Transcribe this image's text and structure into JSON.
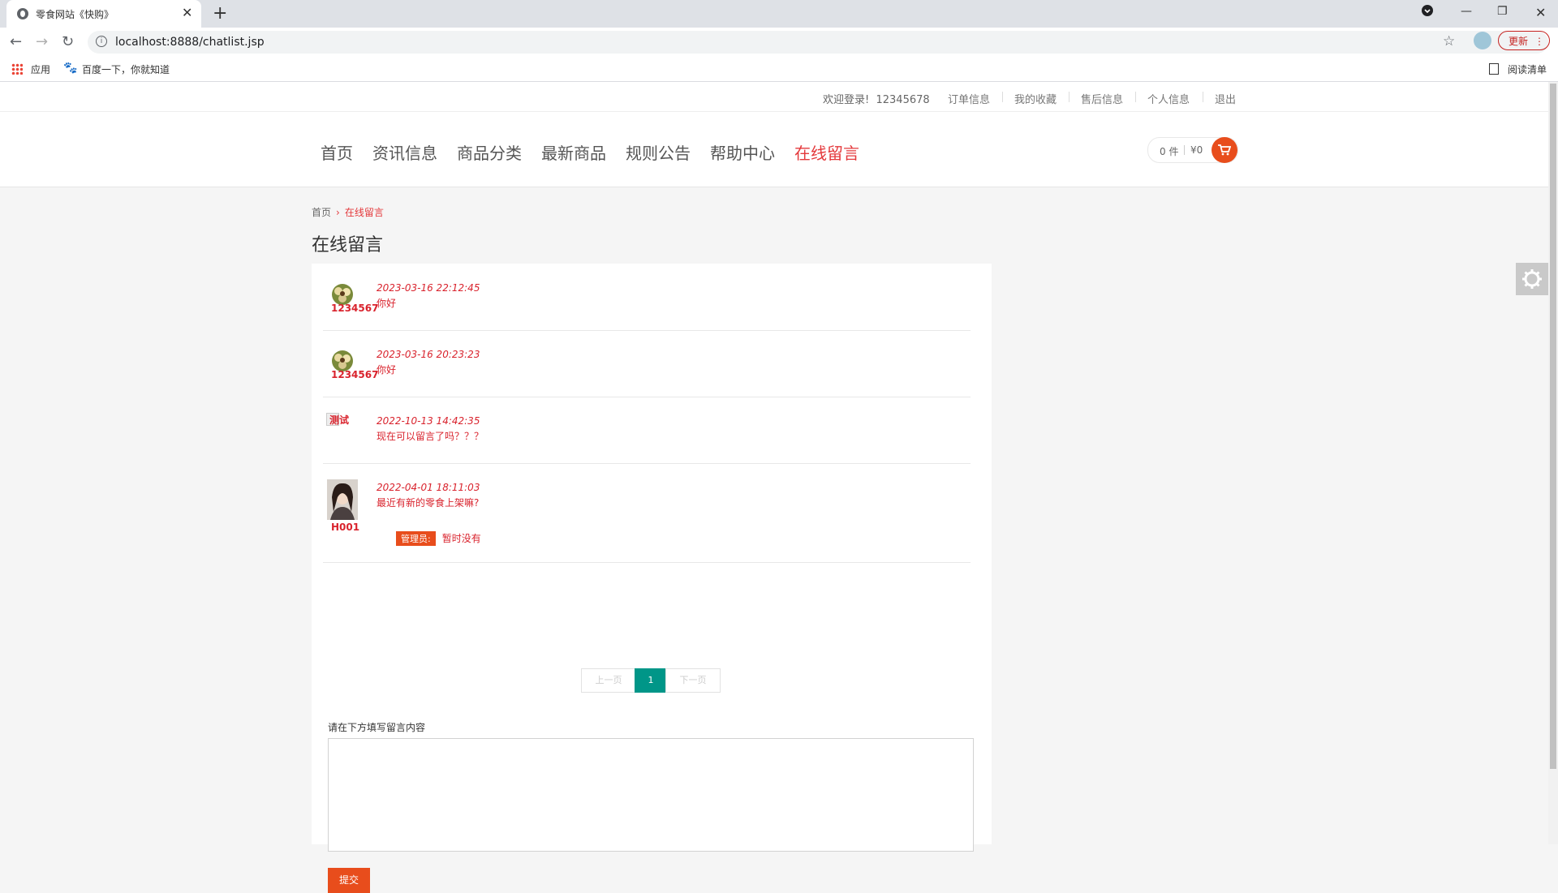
{
  "browser": {
    "tab_title": "零食网站《快购》",
    "url": "localhost:8888/chatlist.jsp",
    "update_label": "更新",
    "bookmarks": [
      "应用",
      "百度一下，你就知道"
    ],
    "reading_list": "阅读清单"
  },
  "topbar": {
    "welcome": "欢迎登录!",
    "username": "12345678",
    "links": [
      "订单信息",
      "我的收藏",
      "售后信息",
      "个人信息",
      "退出"
    ]
  },
  "nav": {
    "items": [
      "首页",
      "资讯信息",
      "商品分类",
      "最新商品",
      "规则公告",
      "帮助中心",
      "在线留言"
    ],
    "active_index": 6
  },
  "cart": {
    "count": "0 件",
    "price": "¥0"
  },
  "breadcrumb": {
    "home": "首页",
    "arrow": "›",
    "current": "在线留言"
  },
  "page_title": "在线留言",
  "messages": [
    {
      "user": "1234567",
      "time": "2023-03-16 22:12:45",
      "content": "你好",
      "avatar": "flower-icon"
    },
    {
      "user": "1234567",
      "time": "2023-03-16 20:23:23",
      "content": "你好",
      "avatar": "flower-icon"
    },
    {
      "user": "测试",
      "time": "2022-10-13 14:42:35",
      "content": "现在可以留言了吗？？？",
      "avatar": "broken-image-icon"
    },
    {
      "user": "H001",
      "time": "2022-04-01 18:11:03",
      "content": "最近有新的零食上架嘛?",
      "avatar": "portrait-icon",
      "admin_tag": "管理员:",
      "admin_reply": "暂时没有"
    }
  ],
  "pager": {
    "prev": "上一页",
    "current": "1",
    "next": "下一页"
  },
  "form": {
    "label": "请在下方填写留言内容",
    "textarea_value": "",
    "submit": "提交"
  },
  "colors": {
    "accent": "#e4393c",
    "orange": "#e84d1c",
    "pager_active": "#009688"
  }
}
